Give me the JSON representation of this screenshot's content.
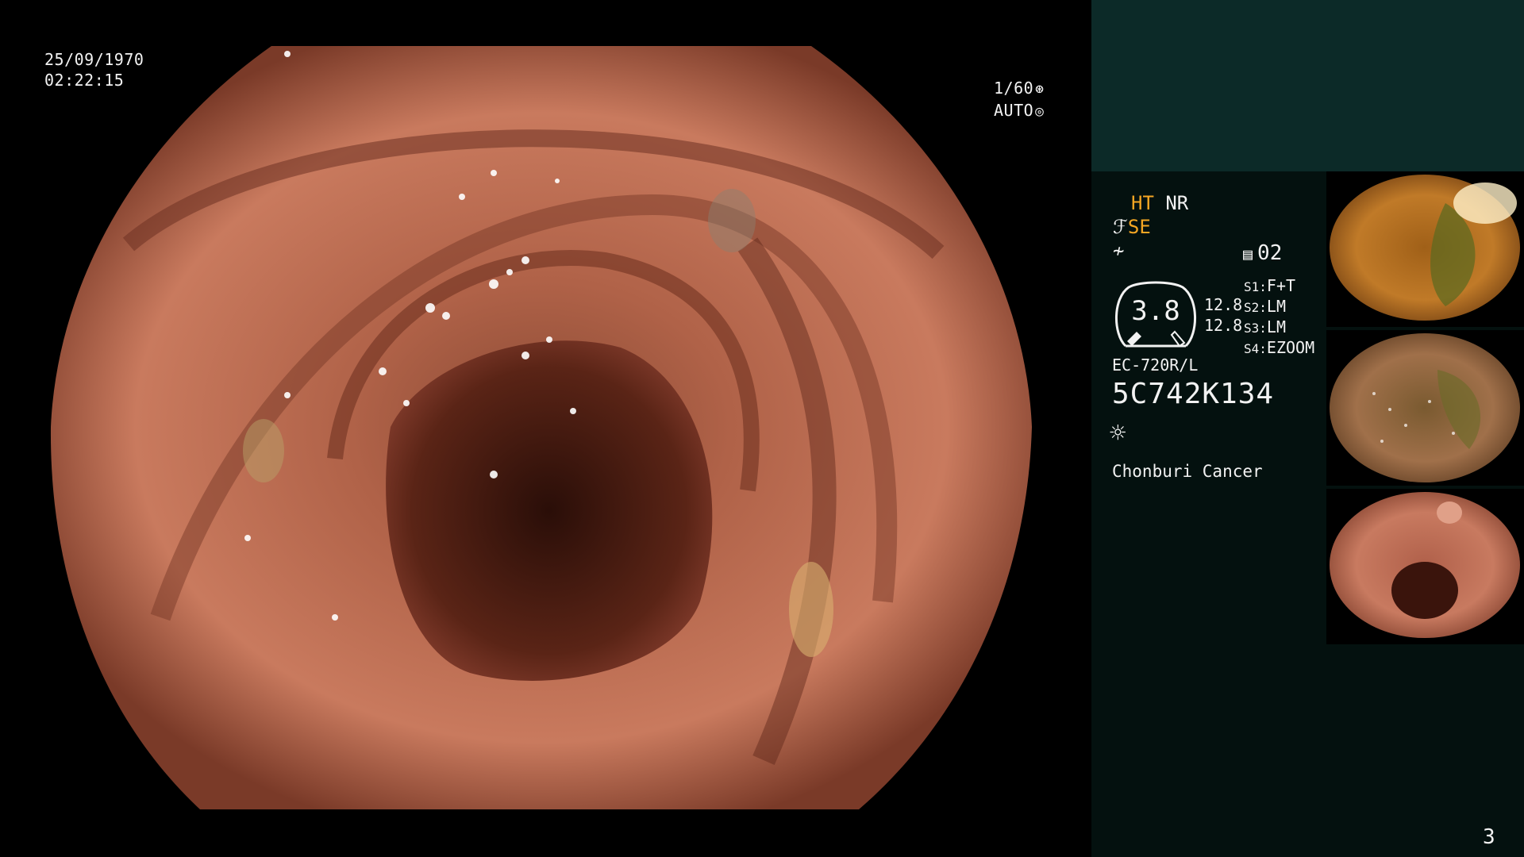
{
  "overlay": {
    "date": "25/09/1970",
    "time": "02:22:15",
    "shutter": "1/60",
    "shutter_icon": "aperture-icon",
    "mode": "AUTO",
    "mode_icon": "iris-icon"
  },
  "settings": {
    "ht_label": "HT",
    "nr_label": "NR",
    "se_label": "SE",
    "memory_label": "02",
    "gauge_value": "3.8",
    "gauge_reading_1": "12.8",
    "gauge_reading_2": "12.8",
    "switches": [
      {
        "key": "S1:",
        "value": "F+T"
      },
      {
        "key": "S2:",
        "value": "LM"
      },
      {
        "key": "S3:",
        "value": "LM"
      },
      {
        "key": "S4:",
        "value": "EZOOM"
      }
    ]
  },
  "scope": {
    "model": "EC-720R/L",
    "serial": "5C742K134"
  },
  "hospital": "Chonburi Cancer",
  "page_number": "3",
  "colors": {
    "accent_orange": "#f5a623",
    "panel_teal": "#0c2a28",
    "panel_dark": "#04110f"
  }
}
